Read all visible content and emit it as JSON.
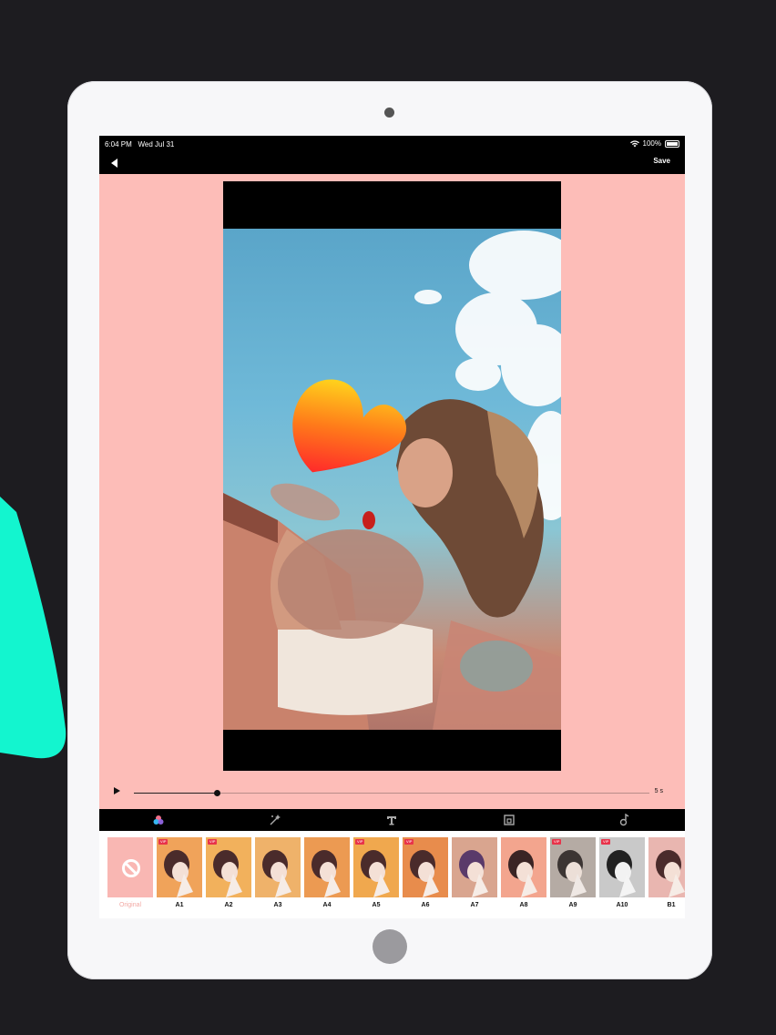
{
  "status_bar": {
    "time": "6:04 PM",
    "date": "Wed Jul 31",
    "battery": "100%"
  },
  "nav": {
    "back_icon": "back-arrow-icon",
    "save_label": "Save"
  },
  "player": {
    "duration_label": "5 s",
    "progress": 0.16
  },
  "toolbar": {
    "tools": [
      {
        "name": "filters",
        "icon": "color-circles-icon"
      },
      {
        "name": "effects",
        "icon": "sparkle-magic-icon"
      },
      {
        "name": "text",
        "icon": "text-t-icon"
      },
      {
        "name": "frame",
        "icon": "frame-layout-icon"
      },
      {
        "name": "music",
        "icon": "music-note-icon"
      }
    ]
  },
  "filters": [
    {
      "label": "Original",
      "vip": false
    },
    {
      "label": "A1",
      "vip": true,
      "tint": "#f0a35a"
    },
    {
      "label": "A2",
      "vip": true,
      "tint": "#f2b15c"
    },
    {
      "label": "A3",
      "vip": false,
      "tint": "#efb26a"
    },
    {
      "label": "A4",
      "vip": false,
      "tint": "#ec9a52"
    },
    {
      "label": "A5",
      "vip": true,
      "tint": "#f0a84e"
    },
    {
      "label": "A6",
      "vip": true,
      "tint": "#e88c4c"
    },
    {
      "label": "A7",
      "vip": false,
      "tint": "#d9a58f"
    },
    {
      "label": "A8",
      "vip": false,
      "tint": "#f3a58e"
    },
    {
      "label": "A9",
      "vip": true,
      "tint": "#b5aba4"
    },
    {
      "label": "A10",
      "vip": true,
      "tint": "#c9c9c9"
    },
    {
      "label": "B1",
      "vip": false,
      "tint": "#e9b6b0"
    }
  ],
  "vip_badge": "VIP"
}
